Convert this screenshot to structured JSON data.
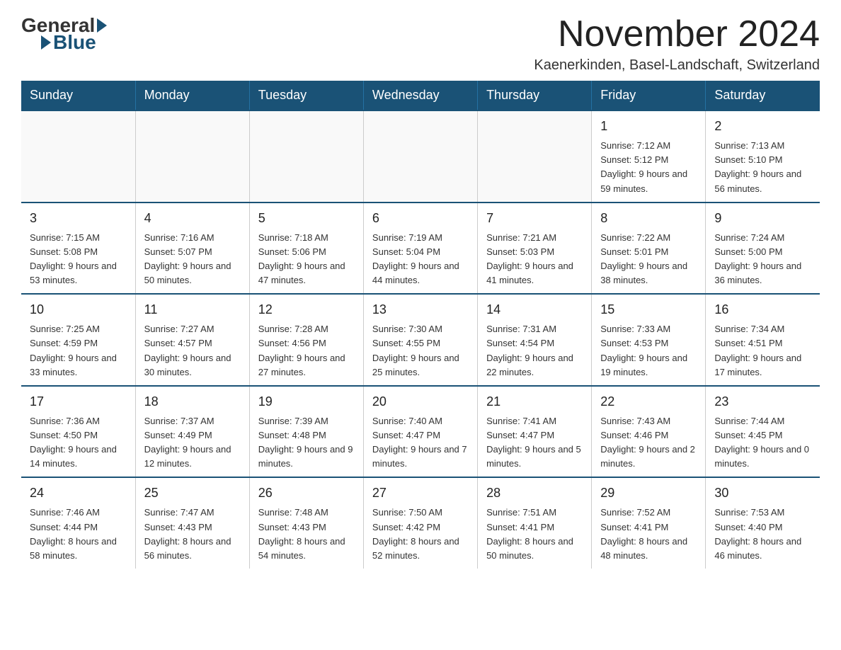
{
  "logo": {
    "general": "General",
    "blue": "Blue"
  },
  "title": "November 2024",
  "subtitle": "Kaenerkinden, Basel-Landschaft, Switzerland",
  "days_header": [
    "Sunday",
    "Monday",
    "Tuesday",
    "Wednesday",
    "Thursday",
    "Friday",
    "Saturday"
  ],
  "weeks": [
    [
      {
        "day": "",
        "info": ""
      },
      {
        "day": "",
        "info": ""
      },
      {
        "day": "",
        "info": ""
      },
      {
        "day": "",
        "info": ""
      },
      {
        "day": "",
        "info": ""
      },
      {
        "day": "1",
        "info": "Sunrise: 7:12 AM\nSunset: 5:12 PM\nDaylight: 9 hours and 59 minutes."
      },
      {
        "day": "2",
        "info": "Sunrise: 7:13 AM\nSunset: 5:10 PM\nDaylight: 9 hours and 56 minutes."
      }
    ],
    [
      {
        "day": "3",
        "info": "Sunrise: 7:15 AM\nSunset: 5:08 PM\nDaylight: 9 hours and 53 minutes."
      },
      {
        "day": "4",
        "info": "Sunrise: 7:16 AM\nSunset: 5:07 PM\nDaylight: 9 hours and 50 minutes."
      },
      {
        "day": "5",
        "info": "Sunrise: 7:18 AM\nSunset: 5:06 PM\nDaylight: 9 hours and 47 minutes."
      },
      {
        "day": "6",
        "info": "Sunrise: 7:19 AM\nSunset: 5:04 PM\nDaylight: 9 hours and 44 minutes."
      },
      {
        "day": "7",
        "info": "Sunrise: 7:21 AM\nSunset: 5:03 PM\nDaylight: 9 hours and 41 minutes."
      },
      {
        "day": "8",
        "info": "Sunrise: 7:22 AM\nSunset: 5:01 PM\nDaylight: 9 hours and 38 minutes."
      },
      {
        "day": "9",
        "info": "Sunrise: 7:24 AM\nSunset: 5:00 PM\nDaylight: 9 hours and 36 minutes."
      }
    ],
    [
      {
        "day": "10",
        "info": "Sunrise: 7:25 AM\nSunset: 4:59 PM\nDaylight: 9 hours and 33 minutes."
      },
      {
        "day": "11",
        "info": "Sunrise: 7:27 AM\nSunset: 4:57 PM\nDaylight: 9 hours and 30 minutes."
      },
      {
        "day": "12",
        "info": "Sunrise: 7:28 AM\nSunset: 4:56 PM\nDaylight: 9 hours and 27 minutes."
      },
      {
        "day": "13",
        "info": "Sunrise: 7:30 AM\nSunset: 4:55 PM\nDaylight: 9 hours and 25 minutes."
      },
      {
        "day": "14",
        "info": "Sunrise: 7:31 AM\nSunset: 4:54 PM\nDaylight: 9 hours and 22 minutes."
      },
      {
        "day": "15",
        "info": "Sunrise: 7:33 AM\nSunset: 4:53 PM\nDaylight: 9 hours and 19 minutes."
      },
      {
        "day": "16",
        "info": "Sunrise: 7:34 AM\nSunset: 4:51 PM\nDaylight: 9 hours and 17 minutes."
      }
    ],
    [
      {
        "day": "17",
        "info": "Sunrise: 7:36 AM\nSunset: 4:50 PM\nDaylight: 9 hours and 14 minutes."
      },
      {
        "day": "18",
        "info": "Sunrise: 7:37 AM\nSunset: 4:49 PM\nDaylight: 9 hours and 12 minutes."
      },
      {
        "day": "19",
        "info": "Sunrise: 7:39 AM\nSunset: 4:48 PM\nDaylight: 9 hours and 9 minutes."
      },
      {
        "day": "20",
        "info": "Sunrise: 7:40 AM\nSunset: 4:47 PM\nDaylight: 9 hours and 7 minutes."
      },
      {
        "day": "21",
        "info": "Sunrise: 7:41 AM\nSunset: 4:47 PM\nDaylight: 9 hours and 5 minutes."
      },
      {
        "day": "22",
        "info": "Sunrise: 7:43 AM\nSunset: 4:46 PM\nDaylight: 9 hours and 2 minutes."
      },
      {
        "day": "23",
        "info": "Sunrise: 7:44 AM\nSunset: 4:45 PM\nDaylight: 9 hours and 0 minutes."
      }
    ],
    [
      {
        "day": "24",
        "info": "Sunrise: 7:46 AM\nSunset: 4:44 PM\nDaylight: 8 hours and 58 minutes."
      },
      {
        "day": "25",
        "info": "Sunrise: 7:47 AM\nSunset: 4:43 PM\nDaylight: 8 hours and 56 minutes."
      },
      {
        "day": "26",
        "info": "Sunrise: 7:48 AM\nSunset: 4:43 PM\nDaylight: 8 hours and 54 minutes."
      },
      {
        "day": "27",
        "info": "Sunrise: 7:50 AM\nSunset: 4:42 PM\nDaylight: 8 hours and 52 minutes."
      },
      {
        "day": "28",
        "info": "Sunrise: 7:51 AM\nSunset: 4:41 PM\nDaylight: 8 hours and 50 minutes."
      },
      {
        "day": "29",
        "info": "Sunrise: 7:52 AM\nSunset: 4:41 PM\nDaylight: 8 hours and 48 minutes."
      },
      {
        "day": "30",
        "info": "Sunrise: 7:53 AM\nSunset: 4:40 PM\nDaylight: 8 hours and 46 minutes."
      }
    ]
  ]
}
